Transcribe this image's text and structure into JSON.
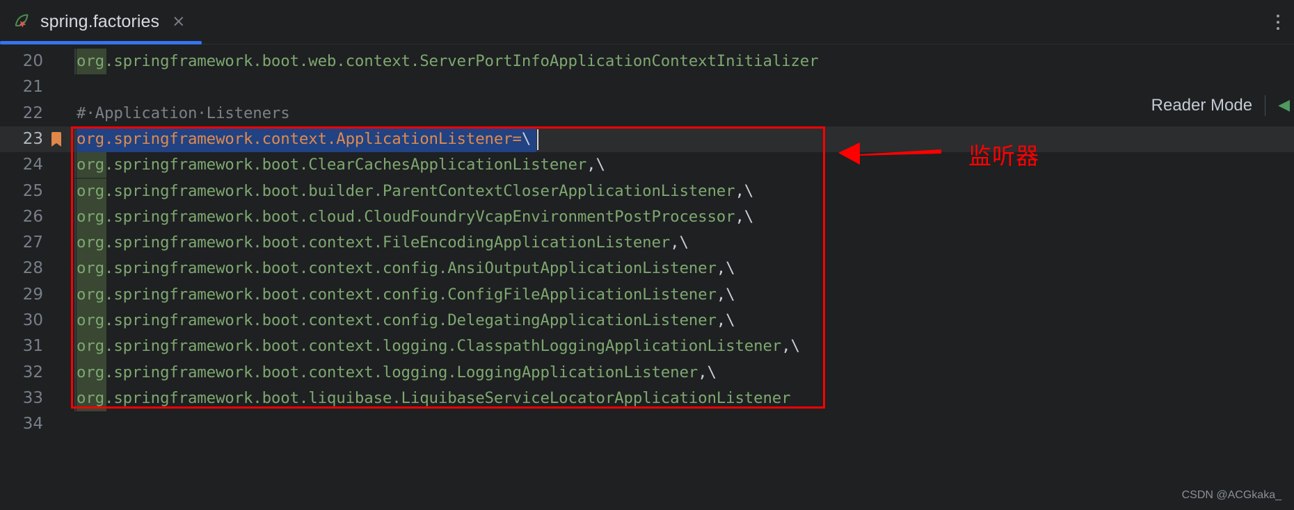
{
  "window": {
    "background_color": "#1e2022"
  },
  "tab": {
    "title": "spring.factories",
    "close_label": "×",
    "icon": "spring-leaf-icon",
    "active_underline_color": "#3574f0"
  },
  "titlebar": {
    "overflow_menu": "kebab-menu-icon"
  },
  "reader_mode": {
    "label": "Reader Mode",
    "chevron": "◀"
  },
  "editor": {
    "selected_line_number": 23,
    "selection_color": "#214283",
    "bookmark_color": "#e0874a",
    "keyword_color": "#7ea86f",
    "comment_color": "#7d8186",
    "selected_text_color": "#e08a4b",
    "lines": [
      {
        "number": "20",
        "text": "org.springframework.boot.web.context.ServerPortInfoApplicationContextInitializer",
        "type": "code",
        "bookmark": false
      },
      {
        "number": "21",
        "text": "",
        "type": "blank",
        "bookmark": false
      },
      {
        "number": "22",
        "text": "#·Application·Listeners",
        "type": "comment",
        "bookmark": false
      },
      {
        "number": "23",
        "text": "org.springframework.context.ApplicationListener=\\",
        "type": "selected",
        "bookmark": true
      },
      {
        "number": "24",
        "text": "org.springframework.boot.ClearCachesApplicationListener,\\",
        "type": "code",
        "bookmark": false
      },
      {
        "number": "25",
        "text": "org.springframework.boot.builder.ParentContextCloserApplicationListener,\\",
        "type": "code",
        "bookmark": false
      },
      {
        "number": "26",
        "text": "org.springframework.boot.cloud.CloudFoundryVcapEnvironmentPostProcessor,\\",
        "type": "code",
        "bookmark": false
      },
      {
        "number": "27",
        "text": "org.springframework.boot.context.FileEncodingApplicationListener,\\",
        "type": "code",
        "bookmark": false
      },
      {
        "number": "28",
        "text": "org.springframework.boot.context.config.AnsiOutputApplicationListener,\\",
        "type": "code",
        "bookmark": false
      },
      {
        "number": "29",
        "text": "org.springframework.boot.context.config.ConfigFileApplicationListener,\\",
        "type": "code",
        "bookmark": false
      },
      {
        "number": "30",
        "text": "org.springframework.boot.context.config.DelegatingApplicationListener,\\",
        "type": "code",
        "bookmark": false
      },
      {
        "number": "31",
        "text": "org.springframework.boot.context.logging.ClasspathLoggingApplicationListener,\\",
        "type": "code",
        "bookmark": false
      },
      {
        "number": "32",
        "text": "org.springframework.boot.context.logging.LoggingApplicationListener,\\",
        "type": "code",
        "bookmark": false
      },
      {
        "number": "33",
        "text": "org.springframework.boot.liquibase.LiquibaseServiceLocatorApplicationListener",
        "type": "code",
        "bookmark": false
      },
      {
        "number": "34",
        "text": "",
        "type": "blank",
        "bookmark": false
      }
    ]
  },
  "annotations": {
    "box_color": "#fe0000",
    "arrow_direction": "left",
    "label": "监听器"
  },
  "watermark": {
    "text": "CSDN @ACGkaka_"
  }
}
